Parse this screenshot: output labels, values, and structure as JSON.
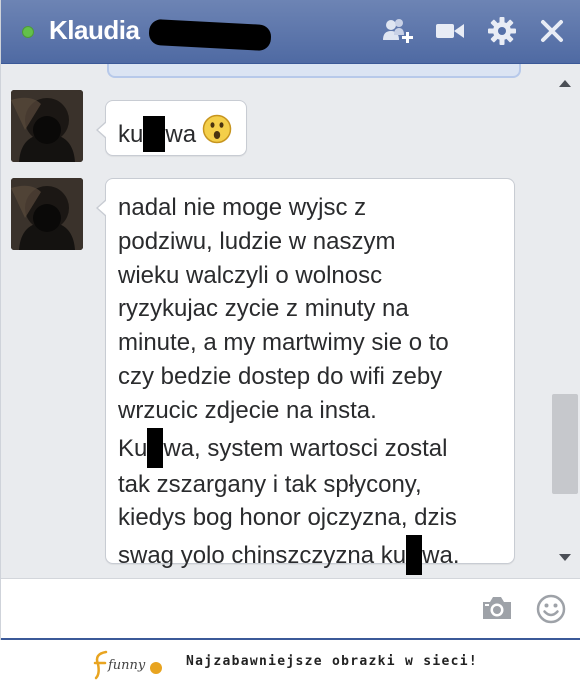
{
  "chat": {
    "contact_name": "Klaudia",
    "status": "online",
    "status_color": "#63c14a",
    "header_color": "#4f6aa3",
    "header_icons": [
      "add-friend-icon",
      "video-call-icon",
      "settings-gear-icon",
      "close-icon"
    ]
  },
  "messages": [
    {
      "sender": "contact",
      "segments": [
        "ku",
        "wa"
      ],
      "emoji": "surprised-face-emoji"
    },
    {
      "sender": "contact",
      "lines": [
        [
          "nadal nie moge wyjsc z"
        ],
        [
          "podziwu, ludzie w naszym"
        ],
        [
          "wieku walczyli o wolnosc"
        ],
        [
          "ryzykujac zycie z minuty na"
        ],
        [
          "minute, a my martwimy sie o to"
        ],
        [
          "czy bedzie dostep do wifi zeby"
        ],
        [
          "wrzucic zdjecie na insta."
        ],
        [
          "Ku",
          "wa, system wartosci zostal"
        ],
        [
          "tak zszargany i tak spłycony,"
        ],
        [
          "kiedys bog honor ojczyzna, dzis"
        ],
        [
          "swag yolo chinszczyzna ku",
          "wa."
        ]
      ]
    }
  ],
  "composer": {
    "placeholder": "",
    "icons": [
      "camera-icon",
      "emoji-icon"
    ]
  },
  "footer": {
    "logo_text": "funny",
    "tagline": "Najzabawniejsze obrazki w sieci!"
  }
}
